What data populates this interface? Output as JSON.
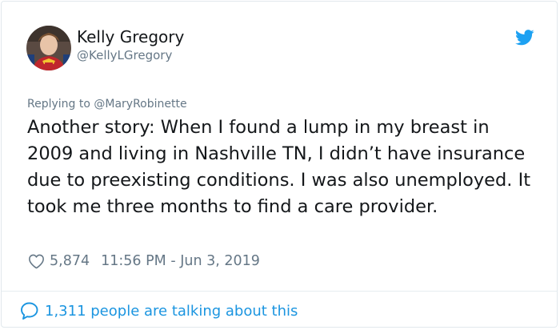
{
  "tweet": {
    "author": {
      "display_name": "Kelly Gregory",
      "handle": "@KellyLGregory",
      "avatar_icon": "user-avatar"
    },
    "platform_icon": "twitter-bird-icon",
    "brand_color": "#1da1f2",
    "replying_to": "Replying to @MaryRobinette",
    "text": "Another story: When I found a lump in my breast in 2009 and living in Nashville TN, I didn’t have insurance due to preexisting conditions. I was also unemployed. It took me three months to find a care provider.",
    "likes": "5,874",
    "timestamp": "11:56 PM - Jun 3, 2019",
    "footer": {
      "icon": "speech-bubble-icon",
      "label": "1,311 people are talking about this",
      "color": "#1b95e0"
    }
  }
}
